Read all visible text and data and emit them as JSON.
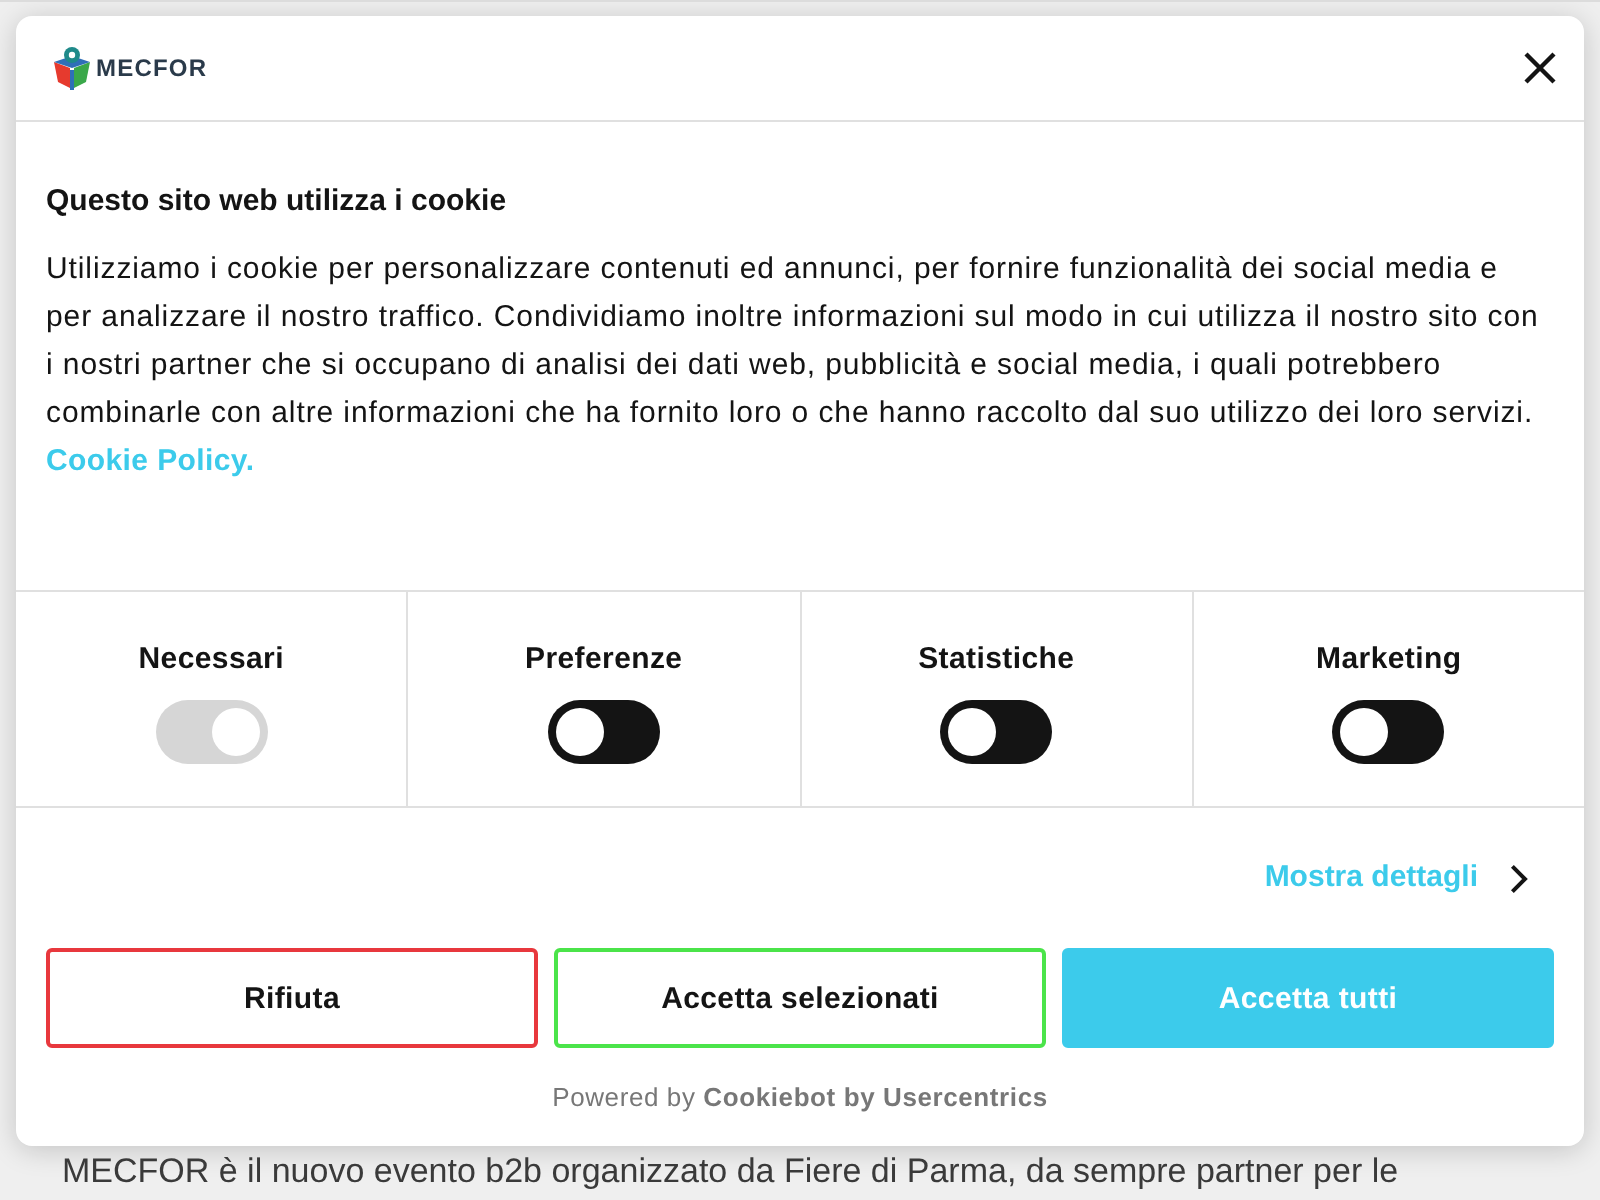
{
  "header": {
    "logo_text": "MECFOR"
  },
  "intro": {
    "title": "Questo sito web utilizza i cookie",
    "body": "Utilizziamo i cookie per personalizzare contenuti ed annunci, per fornire funzionalità dei social media e per analizzare il nostro traffico. Condividiamo inoltre informazioni sul modo in cui utilizza il nostro sito con i nostri partner che si occupano di analisi dei dati web, pubblicità e social media, i quali potrebbero combinarle con altre informazioni che ha fornito loro o che hanno raccolto dal suo utilizzo dei loro servizi.",
    "link": "Cookie Policy."
  },
  "categories": [
    {
      "label": "Necessari",
      "checked": true,
      "disabled": true
    },
    {
      "label": "Preferenze",
      "checked": false,
      "disabled": false
    },
    {
      "label": "Statistiche",
      "checked": false,
      "disabled": false
    },
    {
      "label": "Marketing",
      "checked": false,
      "disabled": false
    }
  ],
  "details_link": "Mostra dettagli",
  "buttons": [
    {
      "label": "Rifiuta",
      "kind": "outline",
      "color": "#e8383d"
    },
    {
      "label": "Accetta selezionati",
      "kind": "outline",
      "color": "#4be44a"
    },
    {
      "label": "Accetta tutti",
      "kind": "filled",
      "color": "#3ccbeb"
    }
  ],
  "footer": "Powered by **Cookiebot by Usercentrics**",
  "background_page": {
    "text": "MECFOR è il nuovo evento b2b organizzato da Fiere di Parma, da sempre partner per le"
  }
}
